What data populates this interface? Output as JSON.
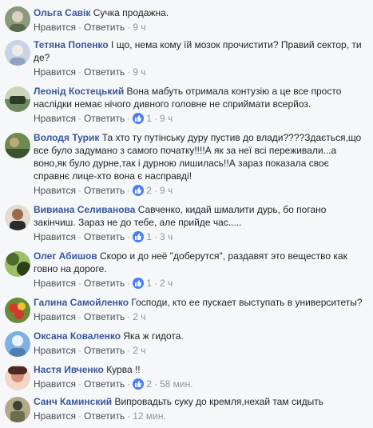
{
  "labels": {
    "like": "Нравится",
    "reply": "Ответить",
    "sep": "·"
  },
  "comments": [
    {
      "author": "Ольга Савік",
      "text": "Сучка продажна.",
      "time": "9 ч",
      "reactions": ""
    },
    {
      "author": "Тетяна Попенко",
      "text": "І що, нема кому їй мозок прочистити? Правий сектор, ти де?",
      "time": "9 ч",
      "reactions": ""
    },
    {
      "author": "Леонід Костецький",
      "text": "Вона мабуть отримала контузію а це все просто наслідки немає нічого дивного головне не сприймати всерйоз.",
      "time": "9 ч",
      "reactions": "1"
    },
    {
      "author": "Володя Турик",
      "text": "Та хто ту путінську дуру пустив до влади????Здається,що все було задумано з самого початку!!!!А як за неї всі переживали...а воно,як було дурне,так і дурною лишилась!!А зараз показала своє справнє лице-хто вона є насправді!",
      "time": "9 ч",
      "reactions": "2"
    },
    {
      "author": "Вивиана Селиванова",
      "text": "Савченко, кидай шмалити дурь, бо погано закінчиш. Зараз не до тебе, але прийде час.....",
      "time": "3 ч",
      "reactions": "1"
    },
    {
      "author": "Олег Абишов",
      "text": "Скоро и до неё \"доберутся\", раздавят это вещество как говно на дороге.",
      "time": "2 ч",
      "reactions": "1"
    },
    {
      "author": "Галина Самойленко",
      "text": "Господи, кто ее пускает выступать в университеты?",
      "time": "2 ч",
      "reactions": ""
    },
    {
      "author": "Оксана Коваленко",
      "text": "Яка ж гидота.",
      "time": "2 ч",
      "reactions": ""
    },
    {
      "author": "Настя Ивченко",
      "text": "Курва !!",
      "time": "58 мин.",
      "reactions": "2"
    },
    {
      "author": "Санч Каминский",
      "text": "Випровадьть суку до кремля,нехай там сидыть",
      "time": "12 мин.",
      "reactions": ""
    }
  ],
  "avatars": [
    {
      "icon": "avatar-photo",
      "colors": [
        "#8a9a7c",
        "#d9d2c5",
        "#5a6a4c"
      ]
    },
    {
      "icon": "avatar-photo",
      "colors": [
        "#c7d4e8",
        "#8ea2c2",
        "#f0ece4"
      ]
    },
    {
      "icon": "avatar-photo",
      "colors": [
        "#6f8b5e",
        "#2e3b2a",
        "#c9d4b8"
      ]
    },
    {
      "icon": "avatar-photo",
      "colors": [
        "#6d8a4f",
        "#3c5230",
        "#c0a67b"
      ]
    },
    {
      "icon": "avatar-photo",
      "colors": [
        "#2b2b2b",
        "#e4dcd3",
        "#9b6a4a"
      ]
    },
    {
      "icon": "avatar-photo",
      "colors": [
        "#4d6b2f",
        "#9cbf6a",
        "#2f3f1e"
      ]
    },
    {
      "icon": "avatar-photo",
      "colors": [
        "#d43a2a",
        "#f1c232",
        "#6a8a3a"
      ]
    },
    {
      "icon": "avatar-photo",
      "colors": [
        "#7fb0e0",
        "#4f7fb0",
        "#eaf2fb"
      ]
    },
    {
      "icon": "avatar-photo",
      "colors": [
        "#d98c7a",
        "#4a2a22",
        "#f2d7c8"
      ]
    },
    {
      "icon": "avatar-photo",
      "colors": [
        "#6b6f4a",
        "#b3a98a",
        "#3e4030"
      ]
    }
  ],
  "colors": {
    "link": "#385898",
    "meta": "#90949c",
    "like_badge": "#4a7ef5"
  }
}
